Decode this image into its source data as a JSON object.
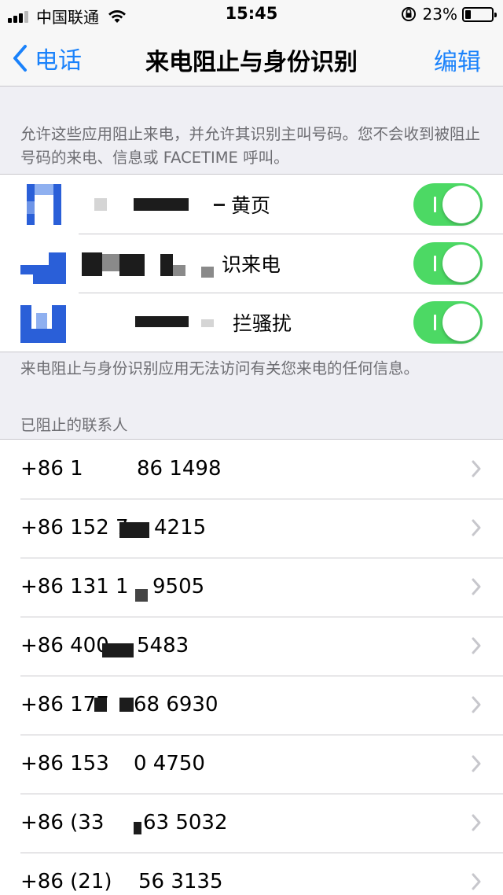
{
  "status_bar": {
    "carrier": "中国联通",
    "time": "15:45",
    "battery": "23%",
    "battery_level": 0.23
  },
  "nav": {
    "back_label": "电话",
    "title": "来电阻止与身份识别",
    "edit_label": "编辑"
  },
  "intro_text": "允许这些应用阻止来电，并允许其识别主叫号码。您不会收到被阻止号码的来电、信息或 FACETIME 呼叫。",
  "apps": [
    {
      "label": "黄页",
      "enabled": true
    },
    {
      "label": "识来电",
      "enabled": true
    },
    {
      "label": "拦骚扰",
      "enabled": true
    }
  ],
  "apps_footer": "来电阻止与身份识别应用无法访问有关您来电的任何信息。",
  "blocked_header": "已阻止的联系人",
  "blocked_contacts": [
    {
      "prefix": "+86 1",
      "suffix": "86 1498"
    },
    {
      "prefix": "+86 152 7",
      "suffix": " 4215"
    },
    {
      "prefix": "+86 131 1",
      "suffix": " 9505"
    },
    {
      "prefix": "+86 400",
      "suffix": " 5483"
    },
    {
      "prefix": "+86 177",
      "suffix": "68 6930"
    },
    {
      "prefix": "+86 153",
      "suffix": "0 4750"
    },
    {
      "prefix": "+86 (33",
      "suffix": "63 5032"
    },
    {
      "prefix": "+86 (21)",
      "suffix": "56 3135"
    }
  ]
}
